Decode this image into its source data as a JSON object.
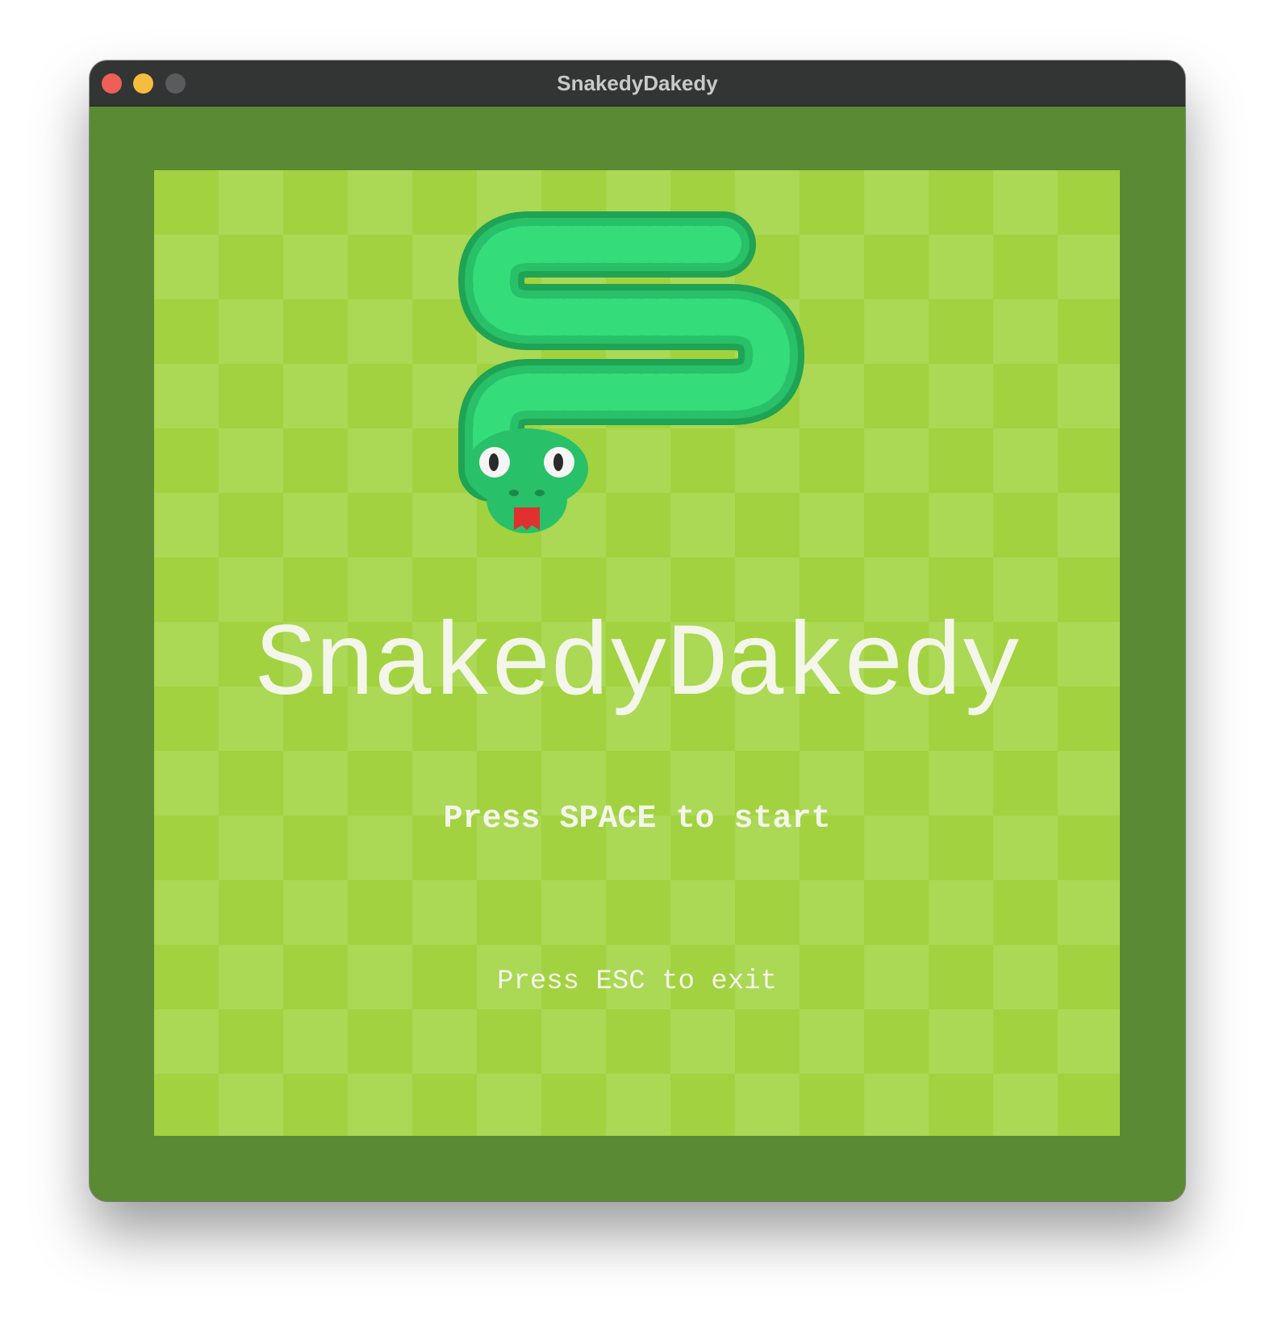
{
  "window": {
    "title": "SnakedyDakedy",
    "traffic_lights": {
      "close_color": "#ee5f57",
      "minimize_color": "#f4bd3e",
      "maximize_color": "#5a5b5c"
    }
  },
  "game": {
    "title": "SnakedyDakedy",
    "start_prompt": "Press SPACE to start",
    "exit_prompt": "Press ESC to exit"
  },
  "colors": {
    "frame": "#5a8a34",
    "board_dark": "#a2d240",
    "board_light": "#abd855",
    "snake_body": "#28c068",
    "snake_highlight": "#34dc7a",
    "tongue": "#e03030",
    "text": "#f4f6ea"
  },
  "icons": {
    "logo": "snake-logo-icon"
  }
}
